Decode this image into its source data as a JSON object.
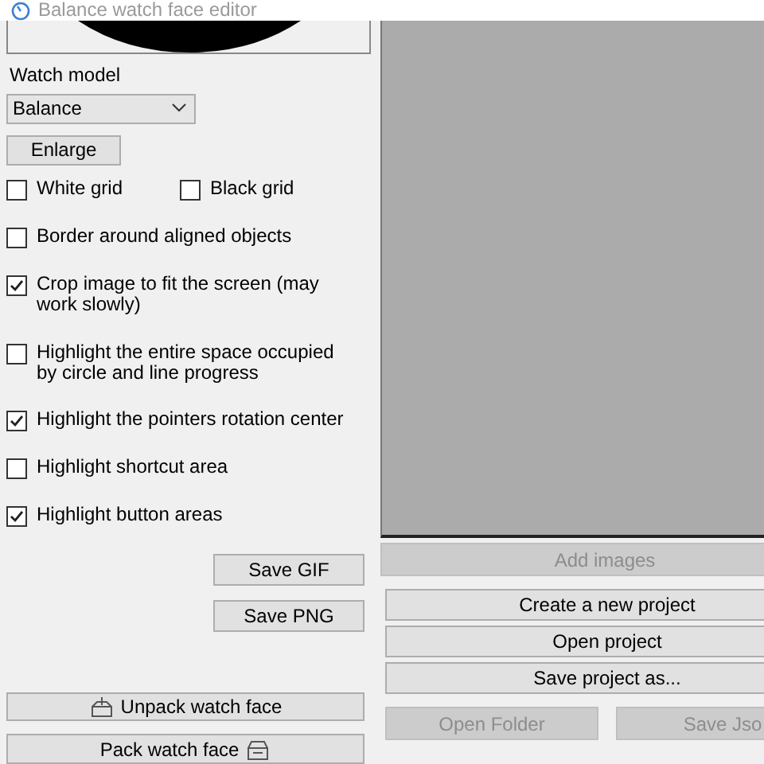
{
  "window": {
    "title": "Balance watch face editor"
  },
  "watch_model": {
    "label": "Watch model",
    "value": "Balance"
  },
  "enlarge_button": "Enlarge",
  "grid_options": [
    {
      "label": "White grid",
      "checked": false
    },
    {
      "label": "Black grid",
      "checked": false
    }
  ],
  "options": [
    {
      "label": "Border around aligned objects",
      "checked": false
    },
    {
      "label": "Crop image to fit the screen (may work slowly)",
      "checked": true
    },
    {
      "label": "Highlight the entire space occupied by circle and line progress",
      "checked": false
    },
    {
      "label": "Highlight the pointers rotation center",
      "checked": true
    },
    {
      "label": "Highlight shortcut area",
      "checked": false
    },
    {
      "label": "Highlight button areas",
      "checked": true
    }
  ],
  "save_buttons": [
    "Save GIF",
    "Save PNG"
  ],
  "unpack_button": "Unpack watch face",
  "pack_button": "Pack watch face",
  "add_images": {
    "label": "Add images",
    "disabled": true
  },
  "project_buttons": [
    "Create a new project",
    "Open project",
    "Save project as..."
  ],
  "bottom_buttons": [
    {
      "label": "Open Folder",
      "disabled": true
    },
    {
      "label": "Save Jso",
      "disabled": true
    }
  ]
}
